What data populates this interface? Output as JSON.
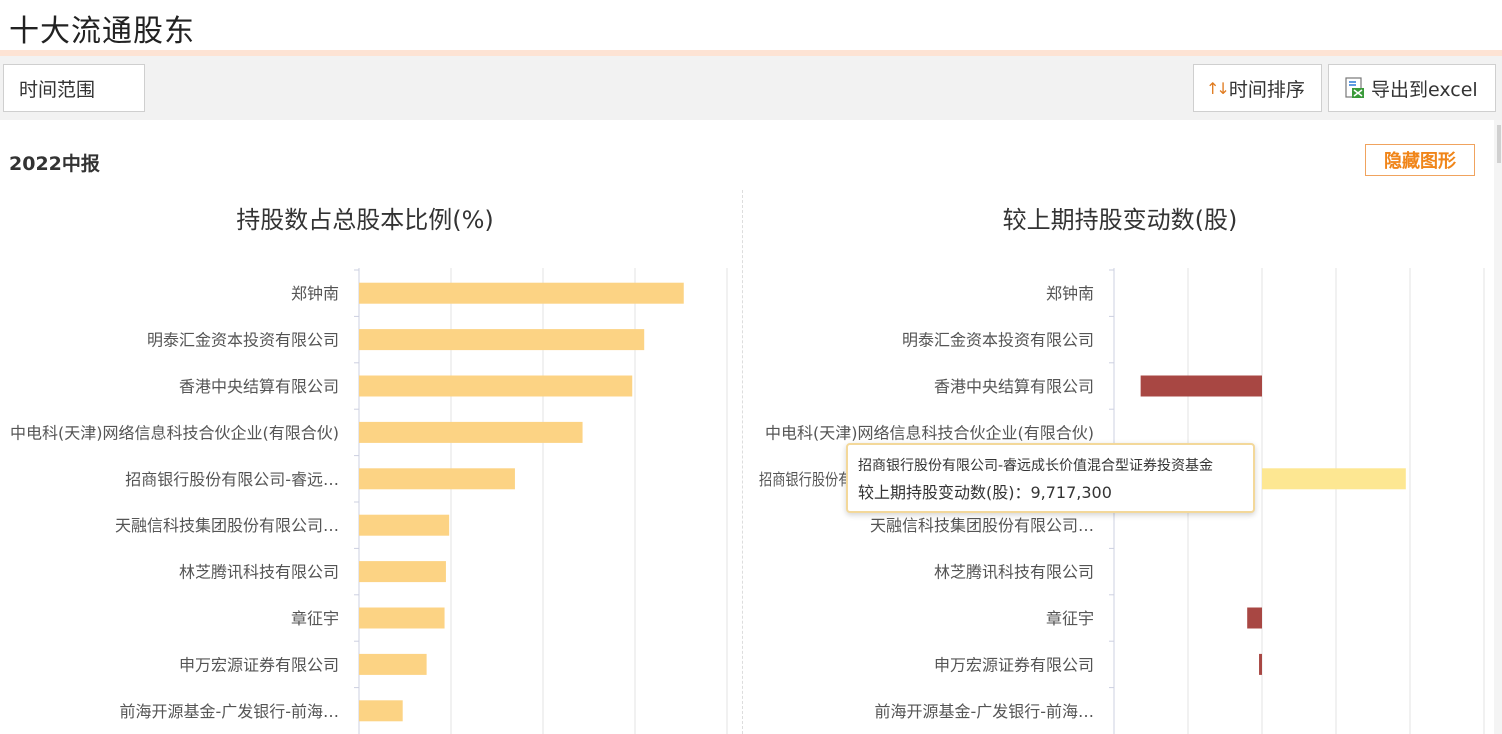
{
  "header": {
    "title": "十大流通股东"
  },
  "toolbar": {
    "range_label": "时间范围",
    "sort_icon": "↑↓",
    "sort_label": "时间排序",
    "export_label": "导出到excel"
  },
  "report": {
    "period": "2022中报",
    "hide_chart_label": "隐藏图形"
  },
  "colors": {
    "ratio_bar": "#fcd384",
    "increase_bar": "#fde792",
    "decrease_bar": "#a84743",
    "accent": "#f08519"
  },
  "chart_data": [
    {
      "type": "bar",
      "orientation": "horizontal",
      "title": "持股数占总股本比例(%)",
      "categories": [
        "郑钟南",
        "明泰汇金资本投资有限公司",
        "香港中央结算有限公司",
        "中电科(天津)网络信息科技合伙企业(有限合伙)",
        "招商银行股份有限公司-睿远…",
        "天融信科技集团股份有限公司…",
        "林芝腾讯科技有限公司",
        "章征宇",
        "申万宏源证券有限公司",
        "前海开源基金-广发银行-前海…"
      ],
      "values": [
        7.06,
        6.2,
        5.94,
        4.86,
        3.39,
        1.96,
        1.89,
        1.86,
        1.47,
        0.95
      ],
      "xlim": [
        0,
        8
      ],
      "grid": true
    },
    {
      "type": "bar",
      "orientation": "horizontal",
      "title": "较上期持股变动数(股)",
      "categories": [
        "郑钟南",
        "明泰汇金资本投资有限公司",
        "香港中央结算有限公司",
        "中电科(天津)网络信息科技合伙企业(有限合伙)",
        "招商银行股份有限公司-睿远成长价值混合型证券投资基金",
        "天融信科技集团股份有限公司…",
        "林芝腾讯科技有限公司",
        "章征宇",
        "申万宏源证券有限公司",
        "前海开源基金-广发银行-前海…"
      ],
      "values": [
        0,
        0,
        -8200000,
        0,
        9717300,
        0,
        0,
        -1000000,
        -200000,
        0
      ],
      "xlim": [
        -10000000,
        15000000
      ],
      "grid": true
    }
  ],
  "tooltip": {
    "name": "招商银行股份有限公司-睿远成长价值混合型证券投资基金",
    "value_label": "较上期持股变动数(股)：9,717,300"
  }
}
